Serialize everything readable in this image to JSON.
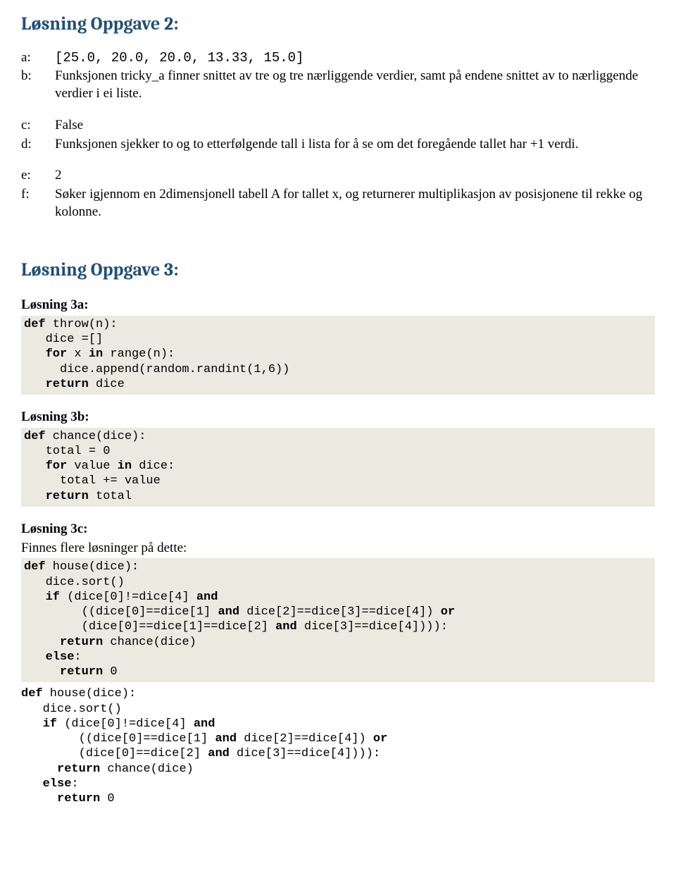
{
  "heading2": "Løsning Oppgave 2:",
  "items2": {
    "a": {
      "label": "a:",
      "text": "[25.0, 20.0, 20.0, 13.33, 15.0]",
      "mono": true
    },
    "b": {
      "label": "b:",
      "text": "Funksjonen tricky_a finner snittet av tre og tre nærliggende verdier, samt på endene snittet av to nærliggende verdier i ei liste."
    },
    "c": {
      "label": "c:",
      "text": "False"
    },
    "d": {
      "label": "d:",
      "text": "Funksjonen sjekker to og to etterfølgende tall i lista for å se om det foregående tallet har +1 verdi."
    },
    "e": {
      "label": "e:",
      "text": "2"
    },
    "f": {
      "label": "f:",
      "text": "Søker igjennom en 2dimensjonell tabell A for tallet x, og returnerer multiplikasjon av posisjonene til rekke og kolonne."
    }
  },
  "heading3": "Løsning Oppgave 3:",
  "s3a": {
    "title": "Løsning 3a:"
  },
  "s3b": {
    "title": "Løsning 3b:"
  },
  "s3c": {
    "title": "Løsning 3c:",
    "note": "Finnes flere løsninger på dette:"
  }
}
